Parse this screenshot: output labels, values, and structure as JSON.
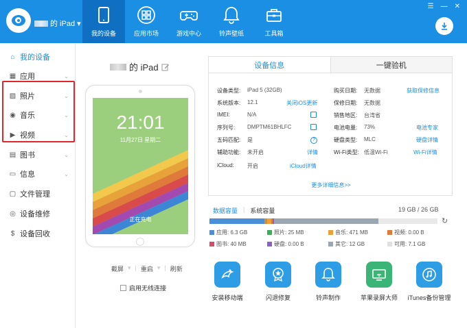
{
  "header": {
    "device_suffix": "的 iPad ▾",
    "nav": [
      {
        "label": "我的设备",
        "icon": "tablet-icon",
        "active": true
      },
      {
        "label": "应用市场",
        "icon": "apps-grid-icon",
        "active": false
      },
      {
        "label": "游戏中心",
        "icon": "gamepad-icon",
        "active": false
      },
      {
        "label": "铃声壁纸",
        "icon": "bell-icon",
        "active": false
      },
      {
        "label": "工具箱",
        "icon": "toolbox-icon",
        "active": false
      }
    ],
    "window_controls": [
      "☰",
      "—",
      "✕"
    ],
    "accent": "#1a8fe3"
  },
  "sidebar": {
    "items": [
      {
        "label": "我的设备",
        "icon": "home-icon",
        "glyph": "⌂",
        "active": true,
        "chevron": false
      },
      {
        "label": "应用",
        "icon": "apps-icon",
        "glyph": "▦",
        "active": false,
        "chevron": true
      },
      {
        "label": "照片",
        "icon": "photo-icon",
        "glyph": "▨",
        "active": false,
        "chevron": true
      },
      {
        "label": "音乐",
        "icon": "music-icon",
        "glyph": "◉",
        "active": false,
        "chevron": true
      },
      {
        "label": "视频",
        "icon": "video-icon",
        "glyph": "▶",
        "active": false,
        "chevron": true
      },
      {
        "label": "图书",
        "icon": "book-icon",
        "glyph": "▤",
        "active": false,
        "chevron": true
      },
      {
        "label": "信息",
        "icon": "message-icon",
        "glyph": "▭",
        "active": false,
        "chevron": true
      },
      {
        "label": "文件管理",
        "icon": "folder-icon",
        "glyph": "▢",
        "active": false,
        "chevron": false
      },
      {
        "label": "设备维修",
        "icon": "repair-icon",
        "glyph": "◎",
        "active": false,
        "chevron": false
      },
      {
        "label": "设备回收",
        "icon": "recycle-icon",
        "glyph": "$",
        "active": false,
        "chevron": false
      }
    ]
  },
  "device": {
    "title_suffix": "的 iPad",
    "time": "21:01",
    "date": "11月27日 星期二",
    "charging": "正在充电",
    "actions": [
      "截屏",
      "重启",
      "刷新"
    ],
    "wireless_label": "启用无线连接"
  },
  "info": {
    "tabs": [
      "设备信息",
      "一键验机"
    ],
    "left": [
      {
        "label": "设备类型:",
        "value": "iPad 5   (32GB)",
        "link": ""
      },
      {
        "label": "系统版本:",
        "value": "12.1",
        "link": "关闭iOS更新"
      },
      {
        "label": "IMEI:",
        "value": "N/A",
        "link": ""
      },
      {
        "label": "序列号:",
        "value": "DMPTM61BHLFC",
        "link": ""
      },
      {
        "label": "五码匹配:",
        "value": "是",
        "link": ""
      },
      {
        "label": "辅助功能:",
        "value": "未开启",
        "link": "详情"
      },
      {
        "label": "iCloud:",
        "value": "开启",
        "link": "iCloud详情"
      }
    ],
    "right": [
      {
        "label": "购买日期:",
        "value": "无数据",
        "link": "获取保修信息"
      },
      {
        "label": "保修日期:",
        "value": "无数据",
        "link": ""
      },
      {
        "label": "销售地区:",
        "value": "台湾省",
        "link": ""
      },
      {
        "label": "电池电量:",
        "value": "73%",
        "link": "电池专家"
      },
      {
        "label": "硬盘类型:",
        "value": "MLC",
        "link": "硬盘详情"
      },
      {
        "label": "Wi-Fi类型:",
        "value": "低温Wi-Fi",
        "link": "Wi-Fi详情"
      }
    ],
    "more": "更多详细信息>>"
  },
  "storage": {
    "tabs": [
      "数据容量",
      "系统容量"
    ],
    "total": "19 GB / 26 GB",
    "segments": [
      {
        "name": "应用",
        "color": "#4a90d9",
        "fraction": 0.242
      },
      {
        "name": "照片",
        "color": "#d98c2b",
        "fraction": 0.01
      },
      {
        "name": "音乐",
        "color": "#e8a23a",
        "fraction": 0.02
      },
      {
        "name": "视频",
        "color": "#e07a3a",
        "fraction": 0.004
      },
      {
        "name": "图书",
        "color": "#d94a6b",
        "fraction": 0.004
      },
      {
        "name": "硬盘",
        "color": "#8a5fc7",
        "fraction": 0.002
      },
      {
        "name": "其它",
        "color": "#9aa6b2",
        "fraction": 0.46
      }
    ],
    "legend": [
      {
        "text": "应用: 6.3 GB",
        "color": "#4a90d9"
      },
      {
        "text": "照片: 25 MB",
        "color": "#3cae5a"
      },
      {
        "text": "音乐: 471 MB",
        "color": "#e8a23a"
      },
      {
        "text": "视频: 0.00 B",
        "color": "#e07a3a"
      },
      {
        "text": "图书: 40 MB",
        "color": "#d94a6b"
      },
      {
        "text": "硬盘: 0.00 B",
        "color": "#8a5fc7"
      },
      {
        "text": "其它: 12 GB",
        "color": "#9aa6b2"
      },
      {
        "text": "可用: 7.1 GB",
        "color": "#e0e0e0"
      }
    ]
  },
  "tools": [
    {
      "label": "安装移动端",
      "icon": "mobile-install-icon",
      "color": "#2d9ee6"
    },
    {
      "label": "闪退修复",
      "icon": "crash-fix-icon",
      "color": "#2d9ee6"
    },
    {
      "label": "铃声制作",
      "icon": "ringtone-icon",
      "color": "#2d9ee6"
    },
    {
      "label": "苹果录屏大师",
      "icon": "screen-record-icon",
      "color": "#3bb577"
    },
    {
      "label": "iTunes备份管理",
      "icon": "itunes-backup-icon",
      "color": "#2d9ee6"
    }
  ]
}
